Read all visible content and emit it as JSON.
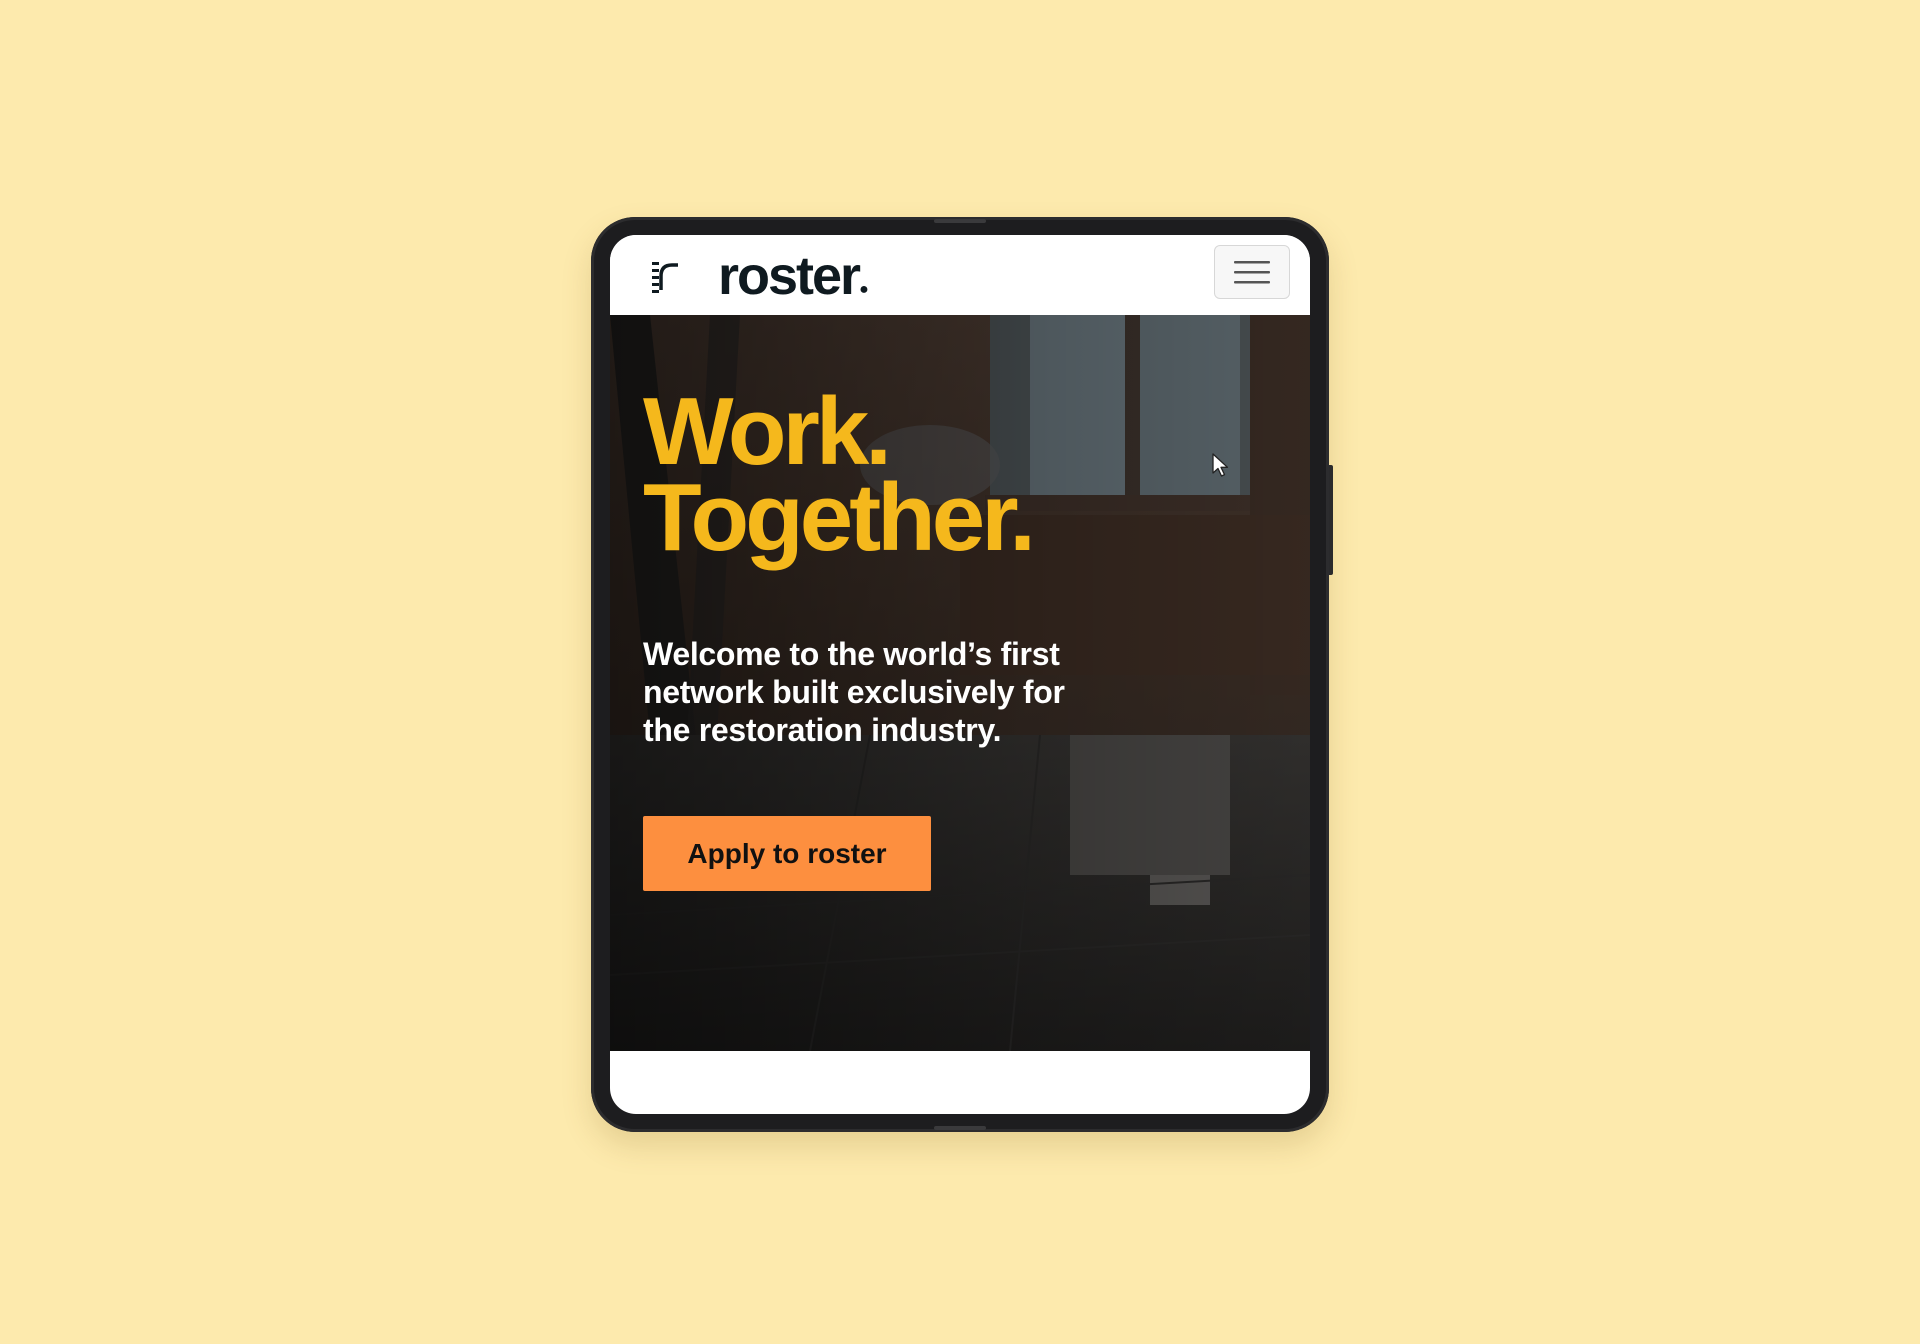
{
  "header": {
    "logo_text": "roster",
    "logo_mark_icon": "roster-stripes-mark",
    "menu_icon": "hamburger-icon"
  },
  "hero": {
    "headline_line1": "Work.",
    "headline_line2": "Together.",
    "tagline_line1": "Welcome to the world’s first",
    "tagline_line2": "network built exclusively for",
    "tagline_line3": "the restoration industry.",
    "cta_label": "Apply to roster"
  },
  "colors": {
    "background": "#fdeaad",
    "headline": "#f5b81c",
    "cta": "#fd8f3f",
    "brand_text": "#0f1a20"
  }
}
